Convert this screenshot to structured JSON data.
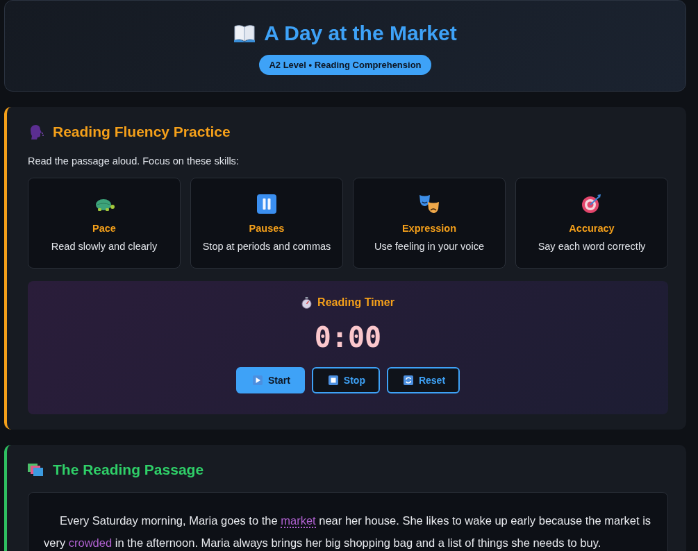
{
  "header": {
    "title": "A Day at the Market",
    "badge": "A2 Level • Reading Comprehension"
  },
  "fluency": {
    "title": "Reading Fluency Practice",
    "intro": "Read the passage aloud. Focus on these skills:",
    "skills": [
      {
        "title": "Pace",
        "text": "Read slowly and clearly"
      },
      {
        "title": "Pauses",
        "text": "Stop at periods and commas"
      },
      {
        "title": "Expression",
        "text": "Use feeling in your voice"
      },
      {
        "title": "Accuracy",
        "text": "Say each word correctly"
      }
    ],
    "timer": {
      "title": "Reading Timer",
      "time": "0:00",
      "buttons": [
        {
          "label": "Start",
          "kind": "primary"
        },
        {
          "label": "Stop",
          "kind": "outline"
        },
        {
          "label": "Reset",
          "kind": "outline"
        }
      ]
    }
  },
  "passage": {
    "title": "The Reading Passage",
    "segments": [
      {
        "kind": "plain",
        "text": "Every Saturday morning, Maria goes to the "
      },
      {
        "kind": "vocab",
        "text": "market",
        "underlined": true
      },
      {
        "kind": "plain",
        "text": " near her house. She likes to wake up early because the market is very "
      },
      {
        "kind": "vocab",
        "text": "crowded",
        "underlined": false
      },
      {
        "kind": "plain",
        "text": " in the afternoon. Maria always brings her big shopping bag and a list of things she needs to buy."
      }
    ]
  }
}
